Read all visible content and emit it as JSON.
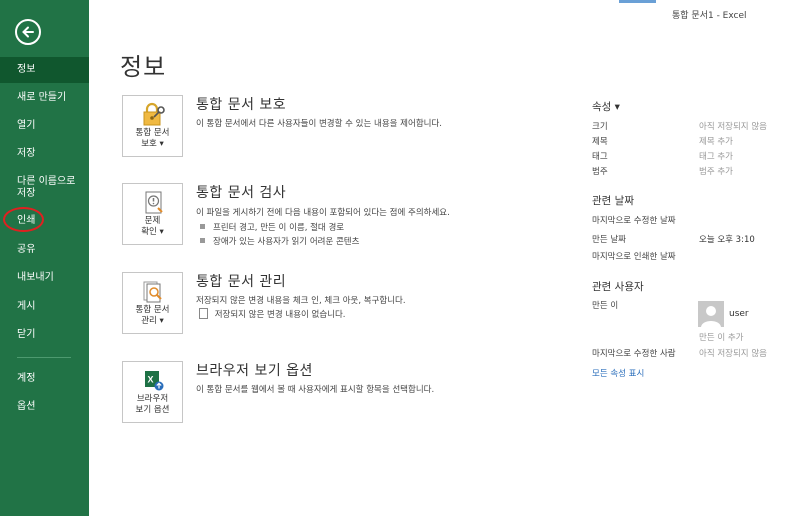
{
  "window": {
    "title": "통합 문서1 - Excel"
  },
  "sidebar": {
    "items": [
      {
        "label": "정보"
      },
      {
        "label": "새로 만들기"
      },
      {
        "label": "열기"
      },
      {
        "label": "저장"
      },
      {
        "label_line1": "다른 이름으로",
        "label_line2": "저장"
      },
      {
        "label": "인쇄"
      },
      {
        "label": "공유"
      },
      {
        "label": "내보내기"
      },
      {
        "label": "게시"
      },
      {
        "label": "닫기"
      },
      {
        "label": "계정"
      },
      {
        "label": "옵션"
      }
    ]
  },
  "main": {
    "title": "정보",
    "sections": [
      {
        "button_line1": "통합 문서",
        "button_line2": "보호 ▾",
        "title": "통합 문서 보호",
        "desc": "이 통합 문서에서 다른 사용자들이 변경할 수 있는 내용을 제어합니다."
      },
      {
        "button_line1": "문제",
        "button_line2": "확인 ▾",
        "title": "통합 문서 검사",
        "desc": "이 파일을 게시하기 전에 다음 내용이 포함되어 있다는 점에 주의하세요.",
        "bullets": [
          "프린터 경고, 만든 이 이름, 절대 경로",
          "장애가 있는 사용자가 읽기 어려운 콘텐츠"
        ]
      },
      {
        "button_line1": "통합 문서",
        "button_line2": "관리 ▾",
        "title": "통합 문서 관리",
        "desc": "저장되지 않은 변경 내용을 체크 인, 체크 아웃, 복구합니다.",
        "note": "저장되지 않은 변경 내용이 없습니다."
      },
      {
        "button_line1": "브라우저",
        "button_line2": "보기 옵션",
        "title": "브라우저 보기 옵션",
        "desc": "이 통합 문서를 웹에서 볼 때 사용자에게 표시할 항목을 선택합니다."
      }
    ]
  },
  "properties": {
    "heading": "속성 ▾",
    "rows": [
      {
        "label": "크기",
        "value": "아직 저장되지 않음"
      },
      {
        "label": "제목",
        "value": "제목 추가"
      },
      {
        "label": "태그",
        "value": "태그 추가"
      },
      {
        "label": "범주",
        "value": "범주 추가"
      }
    ],
    "dates_heading": "관련 날짜",
    "dates": [
      {
        "label": "마지막으로 수정한 날짜",
        "value": ""
      },
      {
        "label": "만든 날짜",
        "value": "오늘 오후 3:10"
      },
      {
        "label": "마지막으로 인쇄한 날짜",
        "value": ""
      }
    ],
    "people_heading": "관련 사용자",
    "author_label": "만든 이",
    "author_name": "user",
    "add_author": "만든 이 추가",
    "last_modified_by_label": "마지막으로 수정한 사람",
    "last_modified_by_value": "아직 저장되지 않음",
    "show_all": "모든 속성 표시"
  },
  "colors": {
    "sidebar": "#217346",
    "sidebar_active": "#10572e",
    "highlight_circle": "#e02020",
    "link": "#2a6ebb"
  }
}
